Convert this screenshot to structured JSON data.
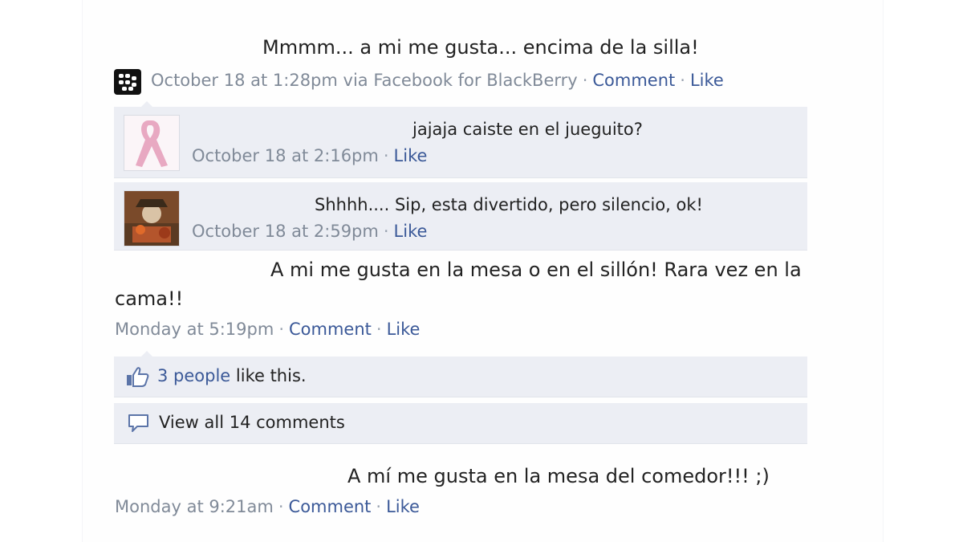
{
  "post1": {
    "text": "Mmmm... a mi me gusta... encima de la silla!",
    "time": "October 18 at 1:28pm via Facebook for BlackBerry",
    "comment": "Comment",
    "like": "Like"
  },
  "comments": [
    {
      "text": "jajaja caiste en el jueguito?",
      "time": "October 18 at 2:16pm",
      "like": "Like",
      "avatar": "pink-ribbon-icon"
    },
    {
      "text": "Shhhh.... Sip, esta divertido, pero silencio, ok!",
      "time": "October 18 at 2:59pm",
      "like": "Like",
      "avatar": "photo-avatar"
    }
  ],
  "post2": {
    "line1": "A mi me gusta en la mesa o en el sillón! Rara vez en la",
    "line2": "cama!!",
    "time": "Monday at 5:19pm",
    "comment": "Comment",
    "like": "Like"
  },
  "likes_row": {
    "people": "3 people",
    "suffix": " like this.",
    "icon": "thumbs-up-icon"
  },
  "view_comments": {
    "label": "View all 14 comments",
    "icon": "comment-bubble-icon"
  },
  "post3": {
    "text": "A mí me gusta en la mesa del comedor!!! ;)",
    "time": "Monday at 9:21am",
    "comment": "Comment",
    "like": "Like"
  },
  "colors": {
    "link": "#3b5998",
    "meta": "#808a98",
    "comment_bg": "#eceef4"
  }
}
